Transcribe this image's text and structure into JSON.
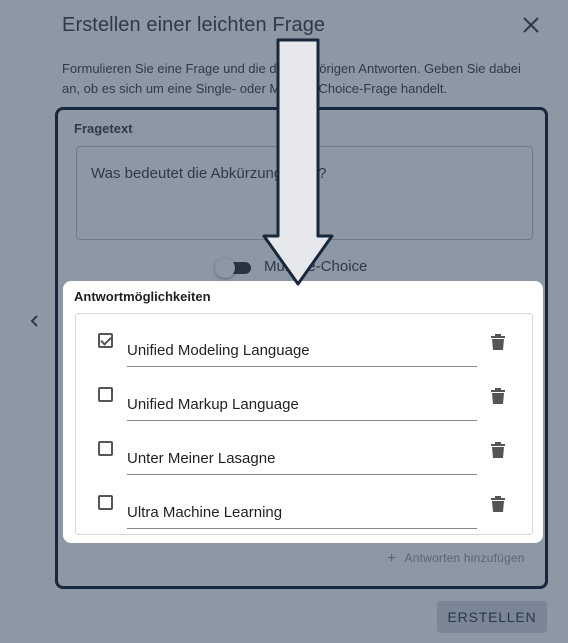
{
  "dialog": {
    "title": "Erstellen einer leichten Frage",
    "description": "Formulieren Sie eine Frage und die dazugehörigen Antworten. Geben Sie dabei an, ob es sich um eine Single- oder Multiple-Choice-Frage handelt.",
    "close_icon": "close-icon"
  },
  "question": {
    "label": "Fragetext",
    "value": "Was bedeutet die Abkürzung UML?"
  },
  "toggle": {
    "label": "Multiple-Choice",
    "on": false
  },
  "answers_section": {
    "label": "Antwortmöglichkeiten",
    "items": [
      {
        "text": "Unified Modeling Language",
        "checked": true
      },
      {
        "text": "Unified Markup Language",
        "checked": false
      },
      {
        "text": "Unter Meiner Lasagne",
        "checked": false
      },
      {
        "text": "Ultra Machine Learning",
        "checked": false
      }
    ],
    "add_label": "Antworten hinzufügen"
  },
  "actions": {
    "create_label": "ERSTELLEN"
  },
  "nav": {
    "prev_icon": "chevron-left-icon"
  },
  "colors": {
    "overlay": "#8e98a4",
    "frame": "#17283d",
    "arrow_fill": "#e6e8ec"
  }
}
